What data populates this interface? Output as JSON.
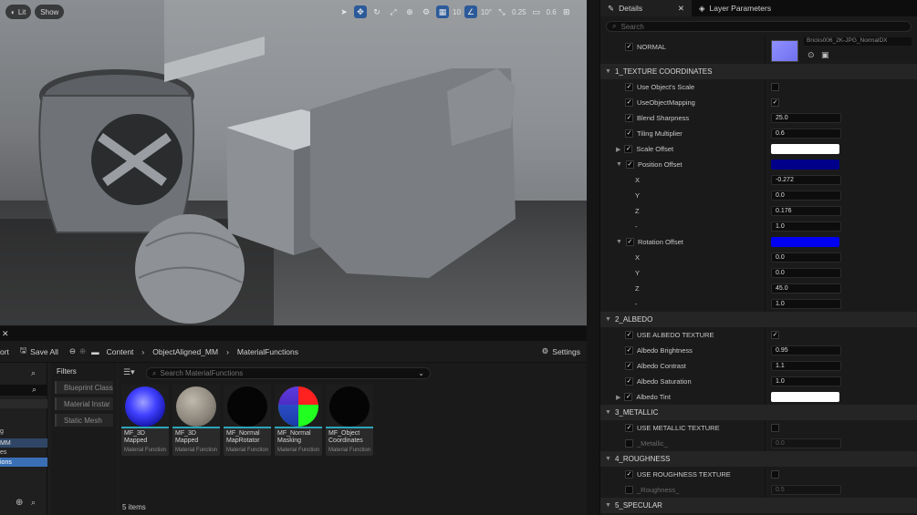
{
  "viewport": {
    "lit_label": "Lit",
    "show_label": "Show",
    "grid_snap": "10",
    "rotation_snap": "10°",
    "scale_snap": "0.25",
    "camera_speed": "0.6"
  },
  "content_browser": {
    "tab_partial": "ort",
    "save_all": "Save All",
    "breadcrumb": [
      "Content",
      "ObjectAligned_MM",
      "MaterialFunctions"
    ],
    "settings": "Settings",
    "filters_title": "Filters",
    "filters": [
      "Blueprint Class",
      "Material Instar",
      "Static Mesh"
    ],
    "search_placeholder": "Search MaterialFunctions",
    "sources_partial": [
      "g",
      "MM",
      "es",
      "ions"
    ],
    "items": [
      {
        "name": "MF_3D Mapped",
        "kind": "Material Function",
        "thumb": "blue-sphere"
      },
      {
        "name": "MF_3D Mapped",
        "kind": "Material Function",
        "thumb": "gray-sphere"
      },
      {
        "name": "MF_Normal MapRotator",
        "kind": "Material Function",
        "thumb": "black-sphere"
      },
      {
        "name": "MF_Normal Masking",
        "kind": "Material Function",
        "thumb": "rgb-sphere"
      },
      {
        "name": "MF_Object Coordinates",
        "kind": "Material Function",
        "thumb": "black-sphere"
      }
    ],
    "item_count": "5 items"
  },
  "details": {
    "tab_details": "Details",
    "tab_layers": "Layer Parameters",
    "search_placeholder": "Search",
    "normal_label": "NORMAL",
    "normal_asset": "Bricks006_2K-JPG_NormalDX",
    "rows": {
      "cat1": "1_TEXTURE COORDINATES",
      "use_object_scale": "Use Object's Scale",
      "use_object_mapping": "UseObjectMapping",
      "blend_sharpness": "Blend Sharpness",
      "blend_sharpness_val": "25.0",
      "tiling_multiplier": "Tiling Multiplier",
      "tiling_multiplier_val": "0.6",
      "scale_offset": "Scale Offset",
      "position_offset": "Position Offset",
      "pos_x": "X",
      "pos_x_val": "-0.272",
      "pos_y": "Y",
      "pos_y_val": "0.0",
      "pos_z": "Z",
      "pos_z_val": "0.176",
      "pos_w": "-",
      "pos_w_val": "1.0",
      "rotation_offset": "Rotation Offset",
      "rot_x": "X",
      "rot_x_val": "0.0",
      "rot_y": "Y",
      "rot_y_val": "0.0",
      "rot_z": "Z",
      "rot_z_val": "45.0",
      "rot_w": "-",
      "rot_w_val": "1.0",
      "cat2": "2_ALBEDO",
      "use_albedo_texture": "USE ALBEDO TEXTURE",
      "albedo_brightness": "Albedo Brightness",
      "albedo_brightness_val": "0.95",
      "albedo_contrast": "Albedo Contrast",
      "albedo_contrast_val": "1.1",
      "albedo_saturation": "Albedo Saturation",
      "albedo_saturation_val": "1.0",
      "albedo_tint": "Albedo Tint",
      "cat3": "3_METALLIC",
      "use_metallic_texture": "USE METALLIC TEXTURE",
      "metallic": "_Metallic_",
      "metallic_val": "0.0",
      "cat4": "4_ROUGHNESS",
      "use_roughness_texture": "USE ROUGHNESS TEXTURE",
      "roughness": "_Roughness_",
      "roughness_val": "0.5",
      "cat5": "5_SPECULAR"
    },
    "colors": {
      "scale_offset": "#ffffff",
      "position_offset": "#00008a",
      "rotation_offset": "#0000f2",
      "albedo_tint": "#ffffff",
      "normal_swatch": "#8080ff"
    }
  }
}
